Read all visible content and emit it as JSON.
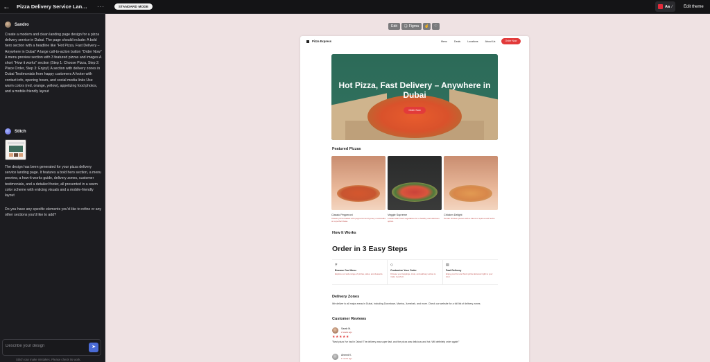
{
  "topbar": {
    "back_icon": "arrow-left-icon",
    "title": "Pizza Delivery Service Landing Page",
    "more_icon": "more-horizontal-icon",
    "mode_badge": "STANDARD MODE",
    "theme_label": "Aa",
    "edit_theme": "Edit theme"
  },
  "chat": {
    "user_name": "Sandro",
    "user_message": "Create a modern and clean landing page design for a pizza delivery service in Dubai. The page should include: A bold hero section with a headline like \"Hot Pizza, Fast Delivery – Anywhere in Dubai\" A large call-to-action button \"Order Now\" A menu preview section with 3 featured pizzas and images A short \"How it works\" section (Step 1: Choose Pizza, Step 2: Place Order, Step 3: Enjoy!) A section with delivery zones in Dubai Testimonials from happy customers A footer with contact info, opening hours, and social media links Use warm colors (red, orange, yellow), appetizing food photos, and a mobile-friendly layout",
    "assistant_name": "Stitch",
    "assistant_message_1": "The design has been generated for your pizza delivery service landing page. It features a bold hero section, a menu preview, a how-it-works guide, delivery zones, customer testimonials, and a detailed footer, all presented in a warm color scheme with enticing visuals and a mobile-friendly layout",
    "assistant_message_2": "Do you have any specific elements you'd like to refine or any other sections you'd like to add?",
    "input_placeholder": "Describe your design",
    "footnote": "Stitch can make mistakes. Please check its work."
  },
  "canvas_toolbar": {
    "edit": "Edit",
    "figma": "Figma"
  },
  "preview": {
    "brand": "Pizza Express",
    "nav": [
      "Menu",
      "Deals",
      "Locations",
      "About Us"
    ],
    "order_nav": "Order Now",
    "hero_title": "Hot Pizza, Fast Delivery – Anywhere in Dubai",
    "hero_button": "Order Now",
    "featured_heading": "Featured Pizzas",
    "pizzas": [
      {
        "name": "Classic Pepperoni",
        "desc": "Classic pizza loaded with pepperoni and gooey mozzarella on a perfect base."
      },
      {
        "name": "Veggie Supreme",
        "desc": "Loaded with fresh vegetables for a healthy and delicious option."
      },
      {
        "name": "Chicken Delight",
        "desc": "Tender chicken pieces with a blend of spices and herbs."
      }
    ],
    "how_heading": "How It Works",
    "steps_heading": "Order in 3 Easy Steps",
    "steps": [
      {
        "title": "Browse Our Menu",
        "desc": "Explore our wide range of pizzas, sides, and desserts.",
        "icon": "search-icon"
      },
      {
        "title": "Customize Your Order",
        "desc": "Choose your toppings, crust, and add any extras to make it perfect.",
        "icon": "diamond-icon"
      },
      {
        "title": "Fast Delivery",
        "desc": "Enjoy your hot and fresh pizza delivered right to your door.",
        "icon": "truck-icon"
      }
    ],
    "zones_heading": "Delivery Zones",
    "zones_text": "We deliver to all major areas in Dubai, including Downtown, Marina, Jumeirah, and more. Check our website for a full list of delivery zones.",
    "reviews_heading": "Customer Reviews",
    "reviews": [
      {
        "name": "Sarah M.",
        "date": "2 weeks ago",
        "stars": "★★★★★",
        "text": "\"Best pizza I've had in Dubai! The delivery was super fast, and the pizza was delicious and hot. Will definitely order again!\""
      },
      {
        "name": "Ahmed K.",
        "date": "1 month ago"
      }
    ]
  }
}
